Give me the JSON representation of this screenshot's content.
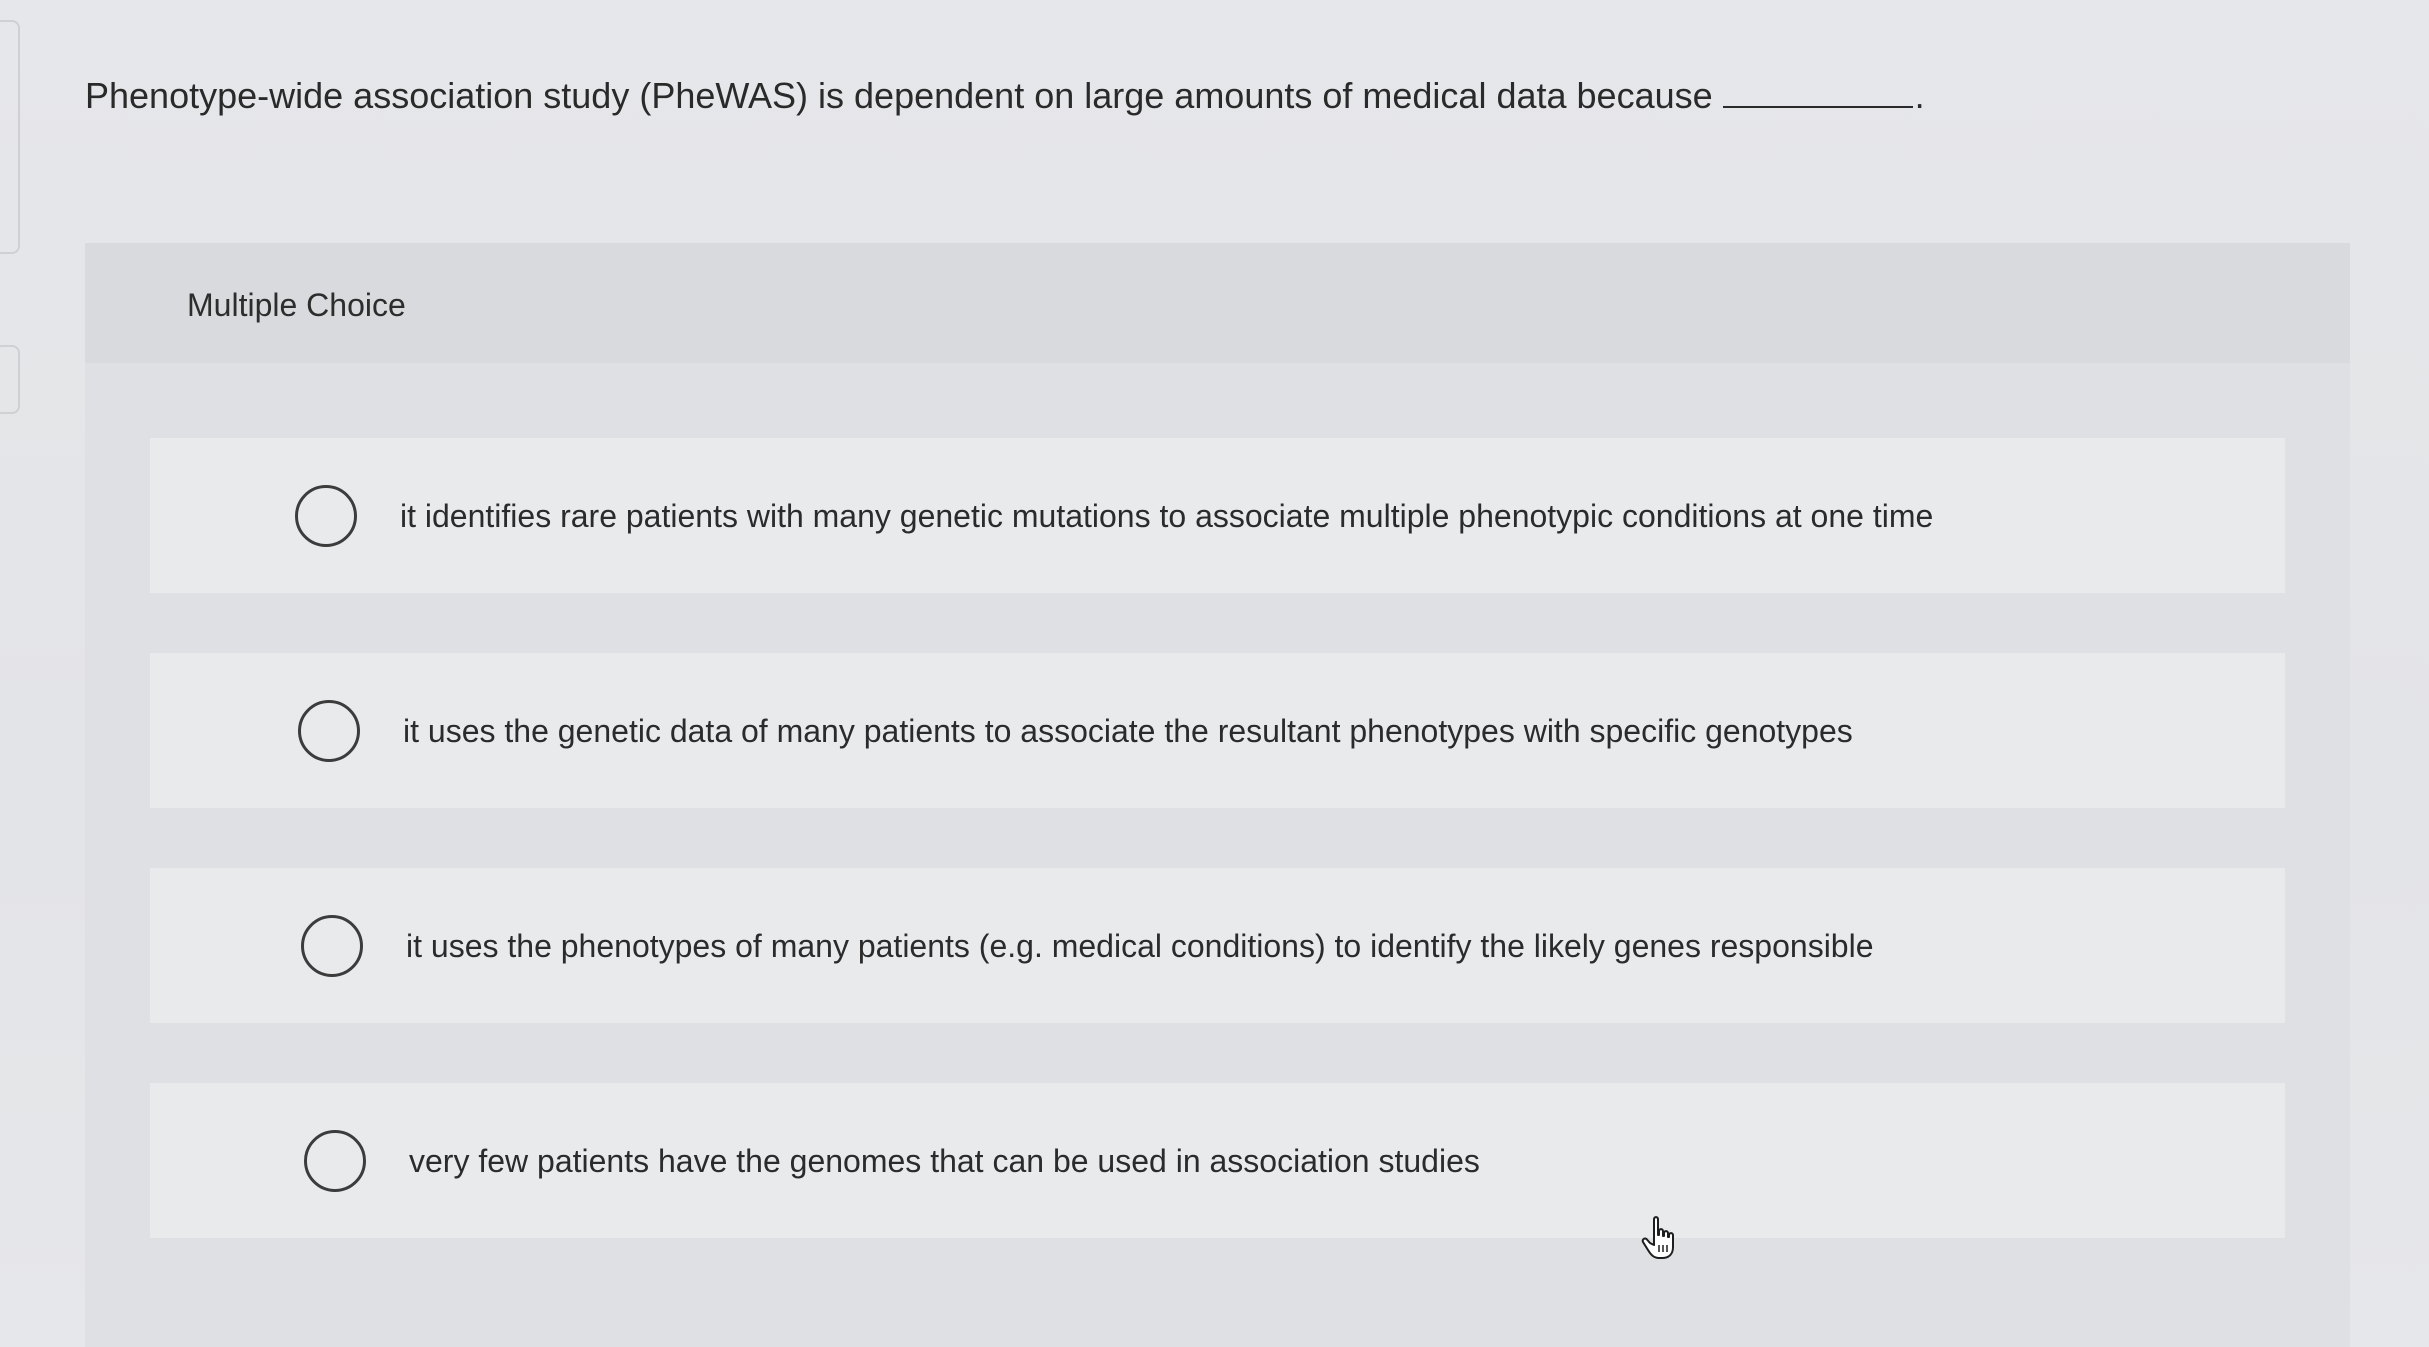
{
  "question": {
    "text": "Phenotype-wide association study (PheWAS) is dependent on large amounts of medical data because",
    "trailing_punctuation": "."
  },
  "multiple_choice": {
    "label": "Multiple Choice",
    "options": [
      {
        "label": "it identifies rare patients with many genetic mutations to associate multiple phenotypic conditions at one time",
        "selected": false
      },
      {
        "label": "it uses the genetic data of many patients to associate the resultant phenotypes with specific genotypes",
        "selected": false
      },
      {
        "label": "it uses the phenotypes of many patients (e.g. medical conditions) to identify the likely genes responsible",
        "selected": false
      },
      {
        "label": "very few patients have the genomes that can be used in association studies",
        "selected": false
      }
    ]
  },
  "cursor": {
    "icon": "hand-pointer-icon"
  },
  "colors": {
    "background": "#e4e5e8",
    "panel": "#dfe0e3",
    "option_background": "#e9eaec",
    "text": "#2b2b2b",
    "radio_border": "#3c3c3c"
  }
}
